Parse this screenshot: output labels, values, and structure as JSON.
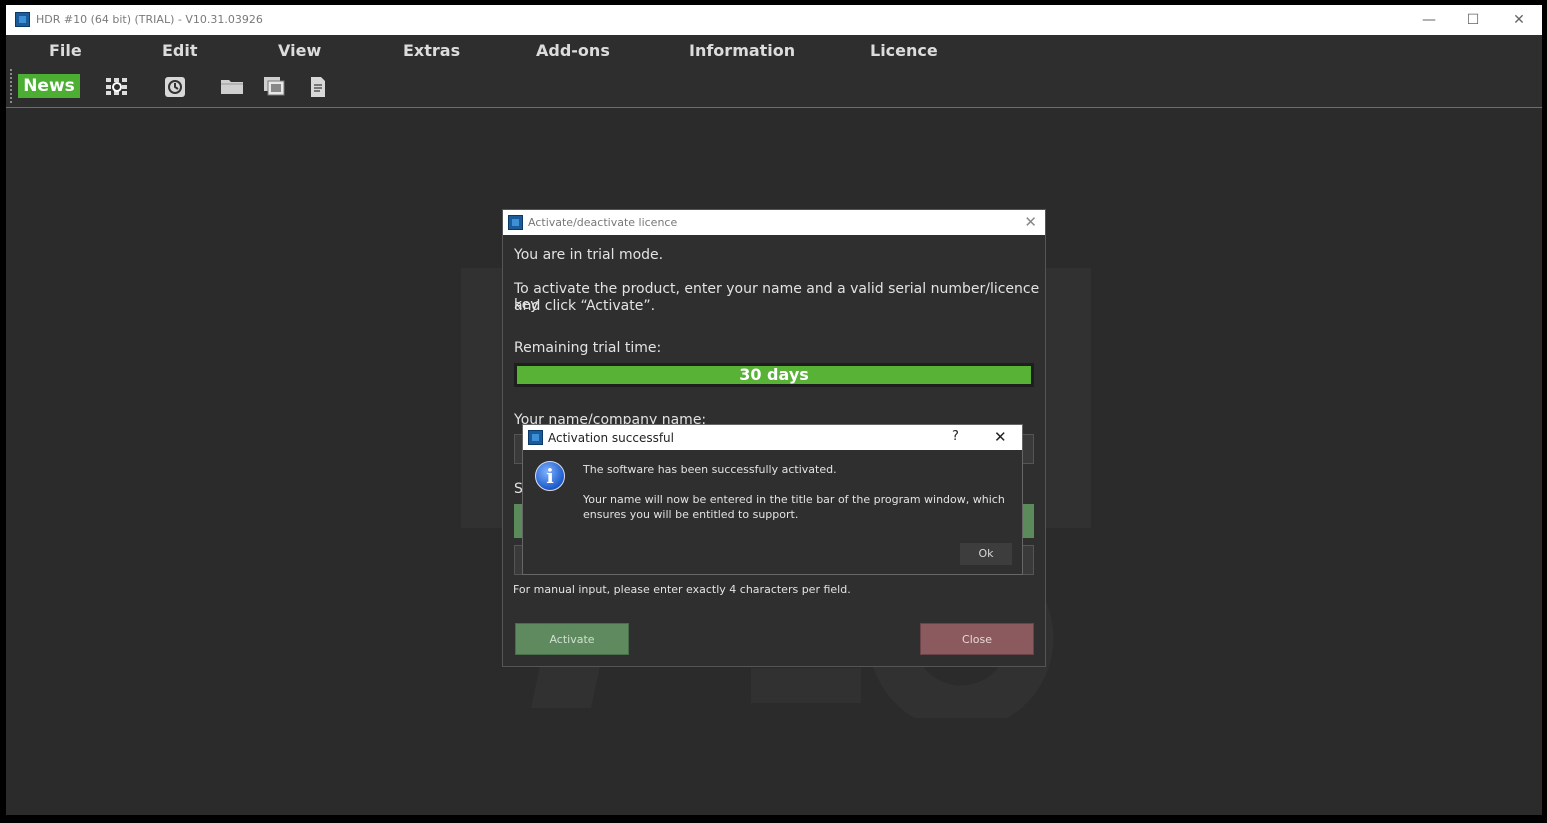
{
  "window": {
    "title": "HDR #10 (64 bit) (TRIAL) - V10.31.03926",
    "controls": {
      "minimize": "—",
      "maximize": "☐",
      "close": "✕"
    }
  },
  "menubar": {
    "items": [
      {
        "label": "File"
      },
      {
        "label": "Edit"
      },
      {
        "label": "View"
      },
      {
        "label": "Extras"
      },
      {
        "label": "Add-ons"
      },
      {
        "label": "Information"
      },
      {
        "label": "Licence"
      }
    ]
  },
  "toolbar": {
    "news_label": "News",
    "icons": [
      "batch-icon",
      "history-icon",
      "folder-icon",
      "gallery-icon",
      "document-icon"
    ]
  },
  "licence_dialog": {
    "title": "Activate/deactivate licence",
    "trial_mode": "You are in trial mode.",
    "instruction_line1": "To activate the product, enter your name and a valid serial number/licence key",
    "instruction_line2": "and click “Activate”.",
    "remaining_label": "Remaining trial time:",
    "remaining_value": "30 days",
    "remaining_fraction": 1.0,
    "name_label": "Your name/company name:",
    "serial_label_partial": "S",
    "hint": "For manual input, please enter exactly 4 characters per field.",
    "activate_label": "Activate",
    "close_label": "Close"
  },
  "message_box": {
    "title": "Activation successful",
    "help": "?",
    "close": "✕",
    "line1": "The software has been successfully activated.",
    "line2": "Your name will now be entered in the title bar of the program window, which",
    "line3": "ensures you will be entitled to support.",
    "ok_label": "Ok"
  },
  "colors": {
    "accent_green": "#57b236",
    "close_red": "#8a5a5e",
    "activate_green": "#5f8a5f"
  }
}
